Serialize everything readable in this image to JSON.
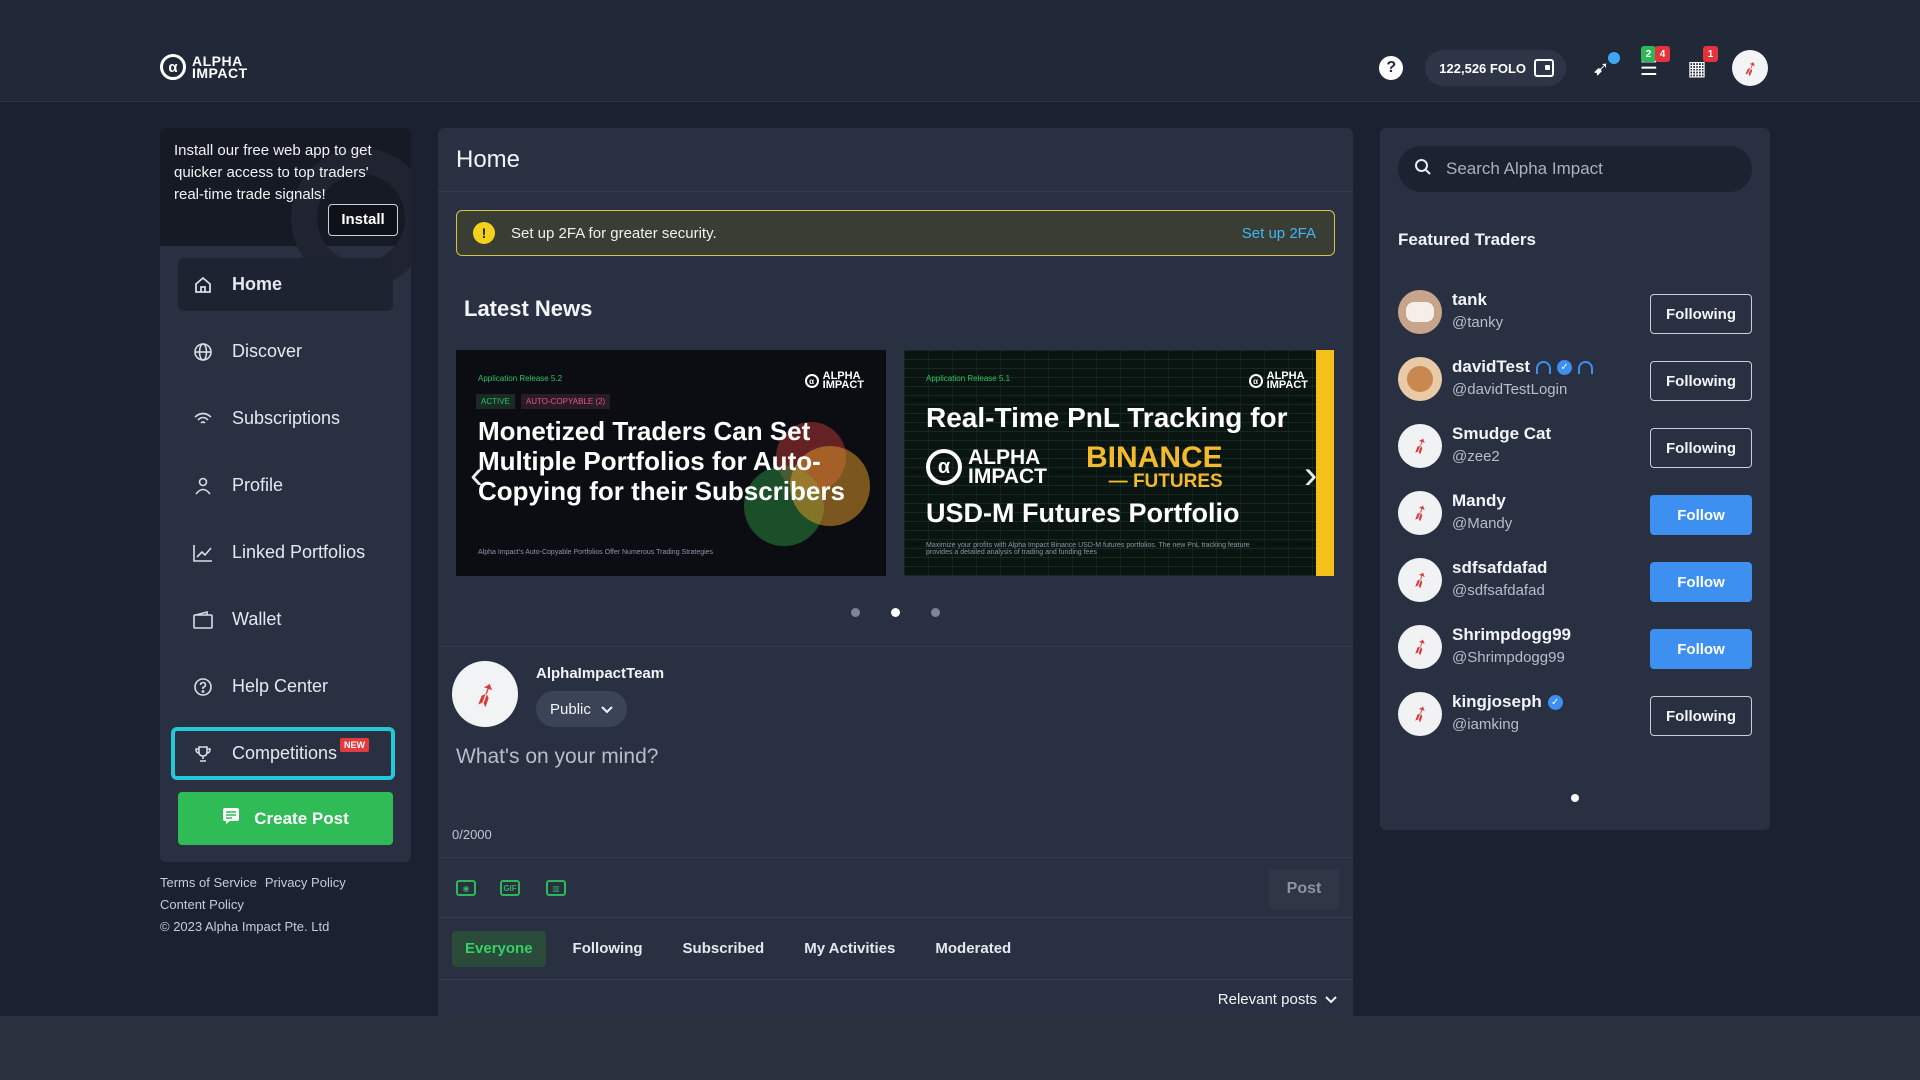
{
  "header": {
    "logo_line1": "ALPHA",
    "logo_line2": "IMPACT",
    "logo_mark": "α",
    "help_glyph": "?",
    "balance": "122,526 FOLO",
    "rewards_badge": "2",
    "tasks_badge": "4",
    "gifts_badge": "1"
  },
  "sidebar": {
    "install_text": "Install our free web app to get quicker access to top traders' real-time trade signals!",
    "install_button": "Install",
    "items": [
      {
        "label": "Home",
        "icon": "home-icon"
      },
      {
        "label": "Discover",
        "icon": "globe-icon"
      },
      {
        "label": "Subscriptions",
        "icon": "wifi-icon"
      },
      {
        "label": "Profile",
        "icon": "user-icon"
      },
      {
        "label": "Linked Portfolios",
        "icon": "chart-icon"
      },
      {
        "label": "Wallet",
        "icon": "wallet-icon"
      },
      {
        "label": "Help Center",
        "icon": "help-icon"
      },
      {
        "label": "Competitions",
        "icon": "trophy-icon"
      }
    ],
    "new_tag": "NEW",
    "create_post": "Create Post"
  },
  "footer": {
    "terms": "Terms of Service",
    "privacy": "Privacy Policy",
    "content": "Content Policy",
    "copyright": "© 2023 Alpha Impact Pte. Ltd"
  },
  "main": {
    "title": "Home",
    "alert_text": "Set up 2FA for greater security.",
    "alert_link": "Set up 2FA",
    "news_heading": "Latest News",
    "card1": {
      "release": "Application Release 5.2",
      "tag1": "ACTIVE",
      "tag2": "AUTO-COPYABLE (2)",
      "headline": "Monetized Traders Can Set Multiple Portfolios for Auto-Copying for their Subscribers",
      "footnote": "Alpha Impact's Auto-Copyable Portfolios Offer Numerous Trading Strategies"
    },
    "card2": {
      "release": "Application Release 5.1",
      "line1": "Real-Time PnL Tracking for",
      "binance": "BINANCE",
      "futures": "— FUTURES",
      "line2": "USD-M Futures Portfolio",
      "footnote": "Maximize your profits with Alpha Impact Binance USD-M futures portfolios. The new PnL tracking feature provides a detailed analysis of trading and funding fees"
    },
    "composer": {
      "username": "AlphaImpactTeam",
      "visibility": "Public",
      "placeholder": "What's on your mind?",
      "counter": "0/2000",
      "gif_label": "GIF",
      "post_button": "Post"
    },
    "tabs": [
      "Everyone",
      "Following",
      "Subscribed",
      "My Activities",
      "Moderated"
    ],
    "sort": "Relevant posts"
  },
  "right": {
    "search_placeholder": "Search Alpha Impact",
    "featured_heading": "Featured Traders",
    "traders": [
      {
        "name": "tank",
        "handle": "@tanky",
        "button": "Following"
      },
      {
        "name": "davidTest",
        "handle": "@davidTestLogin",
        "button": "Following"
      },
      {
        "name": "Smudge Cat",
        "handle": "@zee2",
        "button": "Following"
      },
      {
        "name": "Mandy",
        "handle": "@Mandy",
        "button": "Follow"
      },
      {
        "name": "sdfsafdafad",
        "handle": "@sdfsafdafad",
        "button": "Follow"
      },
      {
        "name": "Shrimpdogg99",
        "handle": "@Shrimpdogg99",
        "button": "Follow"
      },
      {
        "name": "kingjoseph",
        "handle": "@iamking",
        "button": "Following"
      }
    ]
  },
  "colors": {
    "accent_green": "#2fbb55",
    "accent_blue": "#3d8ff0",
    "highlight_cyan": "#23c8d9",
    "background": "#1b2130"
  }
}
